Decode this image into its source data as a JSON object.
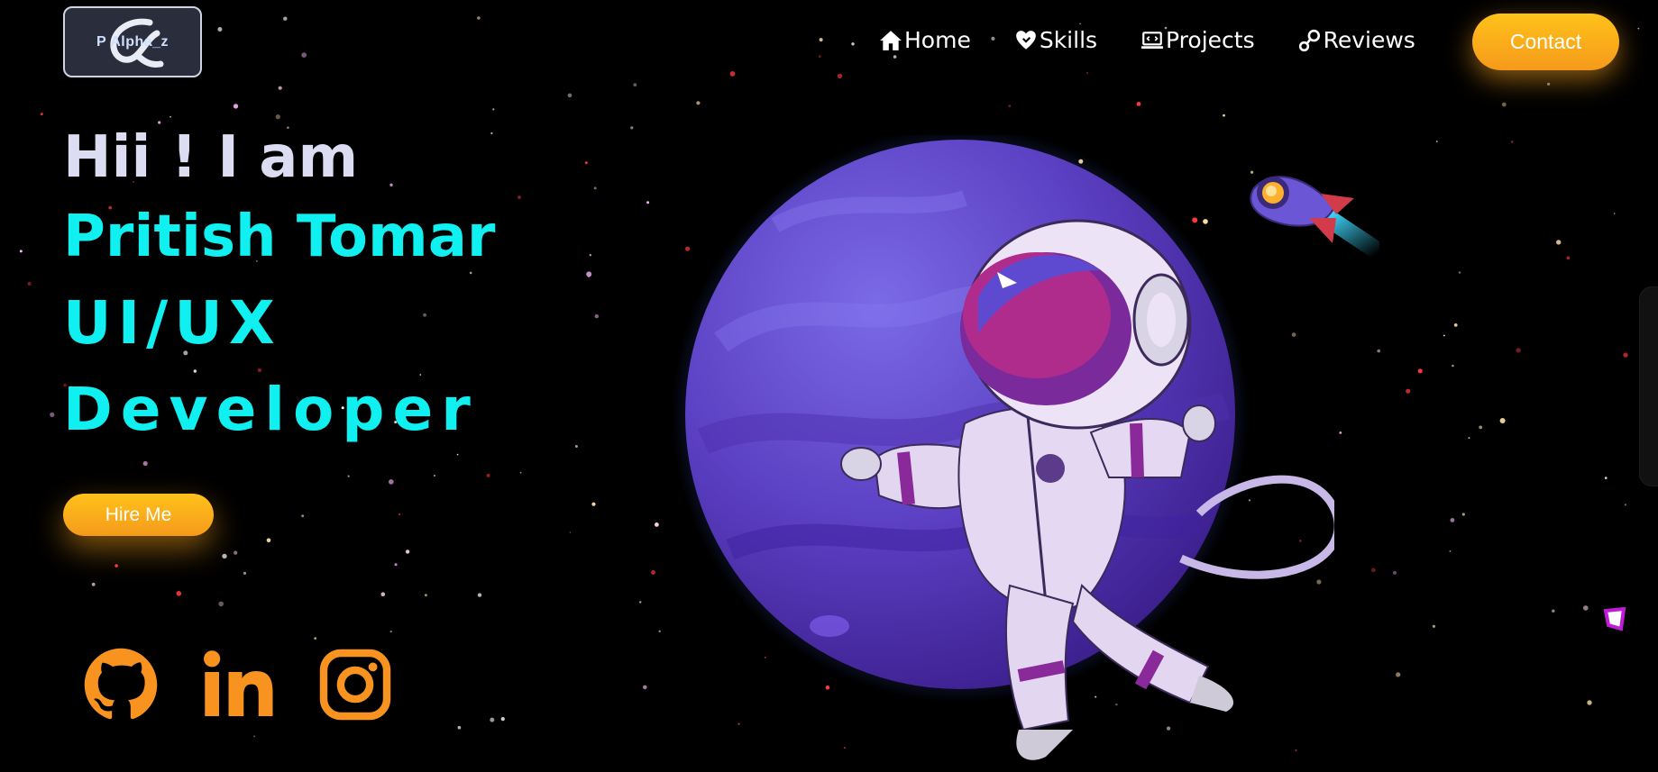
{
  "header": {
    "logo_text": "P Alpha_z",
    "nav": [
      {
        "label": "Home",
        "icon": "home-icon"
      },
      {
        "label": "Skills",
        "icon": "heart-hand-icon"
      },
      {
        "label": "Projects",
        "icon": "laptop-code-icon"
      },
      {
        "label": "Reviews",
        "icon": "link-icon"
      }
    ],
    "contact_label": "Contact"
  },
  "hero": {
    "greeting": "Hii ! I am",
    "name": "Pritish Tomar",
    "role_line1": "UI/UX",
    "role_line2": "Developer",
    "hire_label": "Hire Me"
  },
  "socials": [
    {
      "name": "github-icon"
    },
    {
      "name": "linkedin-icon"
    },
    {
      "name": "instagram-icon"
    }
  ],
  "colors": {
    "background": "#000000",
    "accent_cyan": "#10f0f0",
    "button_orange": "#f8aa1b",
    "social_orange": "#f7931e",
    "planet_purple": "#6a4bd1"
  }
}
